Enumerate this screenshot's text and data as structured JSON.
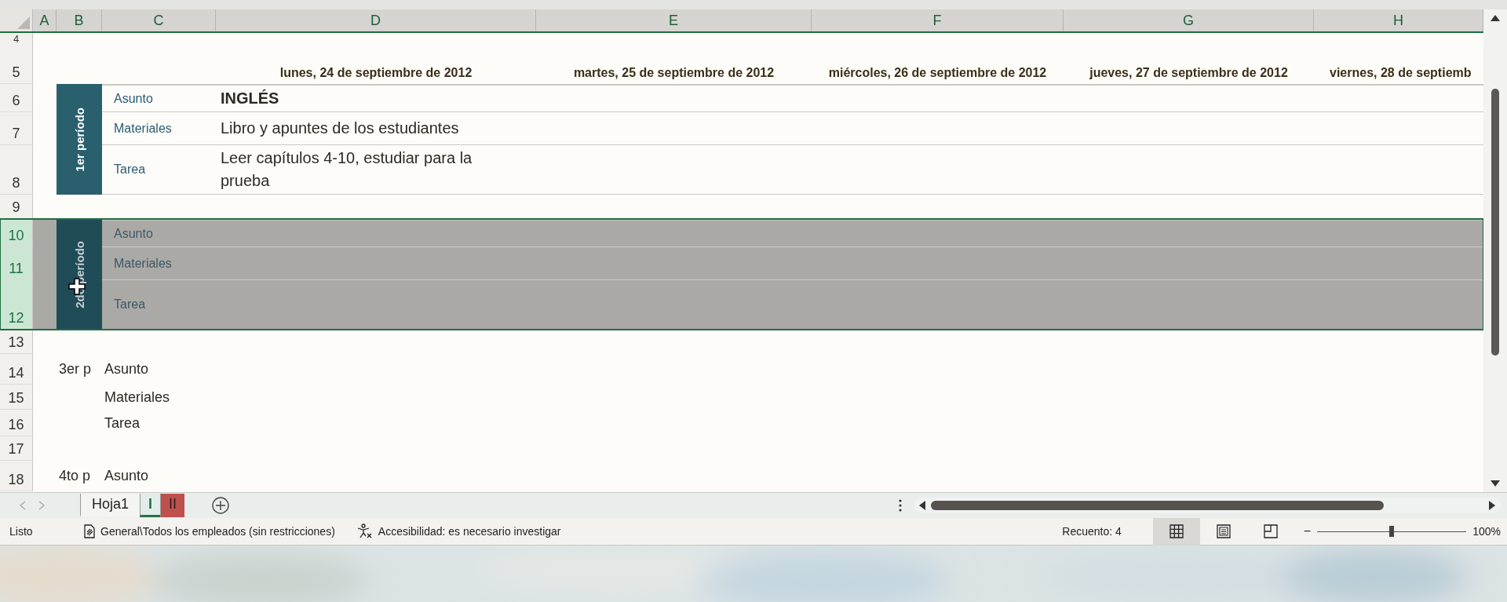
{
  "column_headers": [
    "A",
    "B",
    "C",
    "D",
    "E",
    "F",
    "G",
    "H"
  ],
  "rows": [
    {
      "kind": "blank",
      "number": "4"
    },
    {
      "kind": "dates",
      "number": "5",
      "dates": [
        "lunes, 24 de septiembre de 2012",
        "martes, 25 de septiembre de 2012",
        "miércoles, 26 de septiembre de 2012",
        "jueves, 27 de septiembre de 2012",
        "viernes, 28 de septiemb"
      ]
    },
    {
      "kind": "band_period",
      "selected": false,
      "label": "1er período",
      "lines": [
        {
          "number": "6",
          "label": "Asunto",
          "value": "INGLÉS",
          "bold": true
        },
        {
          "number": "7",
          "label": "Materiales",
          "value": "Libro y apuntes de los estudiantes",
          "bold": false
        },
        {
          "number": "8",
          "label": "Tarea",
          "value": "Leer capítulos 4-10, estudiar para la prueba",
          "bold": false
        }
      ]
    },
    {
      "kind": "blank",
      "number": "9"
    },
    {
      "kind": "band_period",
      "selected": true,
      "label": "2do período",
      "lines": [
        {
          "number": "10",
          "label": "Asunto"
        },
        {
          "number": "11",
          "label": "Materiales"
        },
        {
          "number": "12",
          "label": "Tarea"
        }
      ]
    },
    {
      "kind": "blank",
      "number": "13"
    },
    {
      "kind": "plain_period",
      "selected": false,
      "label": "3er p",
      "lines": [
        {
          "number": "14",
          "label": "Asunto"
        },
        {
          "number": "15",
          "label": "Materiales"
        },
        {
          "number": "16",
          "label": "Tarea"
        }
      ]
    },
    {
      "kind": "blank",
      "number": "17"
    },
    {
      "kind": "plain_period",
      "selected": false,
      "label": "4to p",
      "lines": [
        {
          "number": "18",
          "label": "Asunto"
        }
      ]
    }
  ],
  "sheet_tabs": [
    {
      "label": "Hoja1",
      "selected": false
    },
    {
      "label": "I",
      "selected": true,
      "color": "#217346"
    },
    {
      "label": "II",
      "selected": false,
      "color": "#c0504d"
    }
  ],
  "status_bar": {
    "mode": "Listo",
    "sensitivity": "General\\Todos los empleados (sin restricciones)",
    "accessibility": "Accesibilidad: es necesario investigar",
    "count": "Recuento: 4",
    "views": [
      {
        "kind": "normal",
        "selected": true
      },
      {
        "kind": "page_layout",
        "selected": false
      },
      {
        "kind": "page_break",
        "selected": false
      }
    ],
    "zoom_out": "−",
    "zoom": {
      "level": 0.5
    },
    "zoom_value": "100%"
  }
}
